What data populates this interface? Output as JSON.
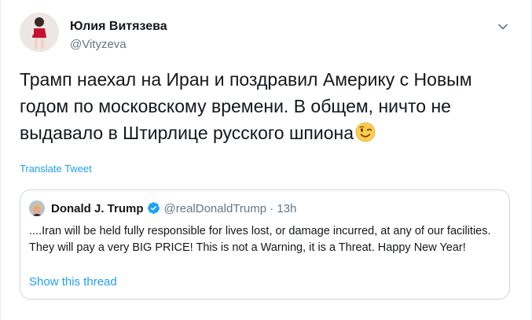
{
  "author": {
    "name": "Юлия Витязева",
    "handle": "@Vityzeva"
  },
  "tweet": {
    "text": "Трамп наехал на Иран и поздравил Америку с Новым годом по московскому времени. В общем, ничто не выдавало в Штирлице русского шпиона",
    "emoji": "winking-face-emoji",
    "translate_label": "Translate Tweet"
  },
  "quoted_tweet": {
    "name": "Donald J. Trump",
    "handle": "@realDonaldTrump",
    "separator": "·",
    "time": "13h",
    "text": "....Iran will be held fully responsible for lives lost, or damage incurred, at any of our facilities. They will pay a very BIG PRICE! This is not a Warning, it is a Threat. Happy New Year!",
    "show_thread_label": "Show this thread"
  },
  "colors": {
    "link": "#1da1f2",
    "secondary_text": "#657786",
    "primary_text": "#14171a",
    "border": "#ccd6dd"
  },
  "icons": [
    "chevron-down-icon",
    "verified-badge-icon"
  ]
}
